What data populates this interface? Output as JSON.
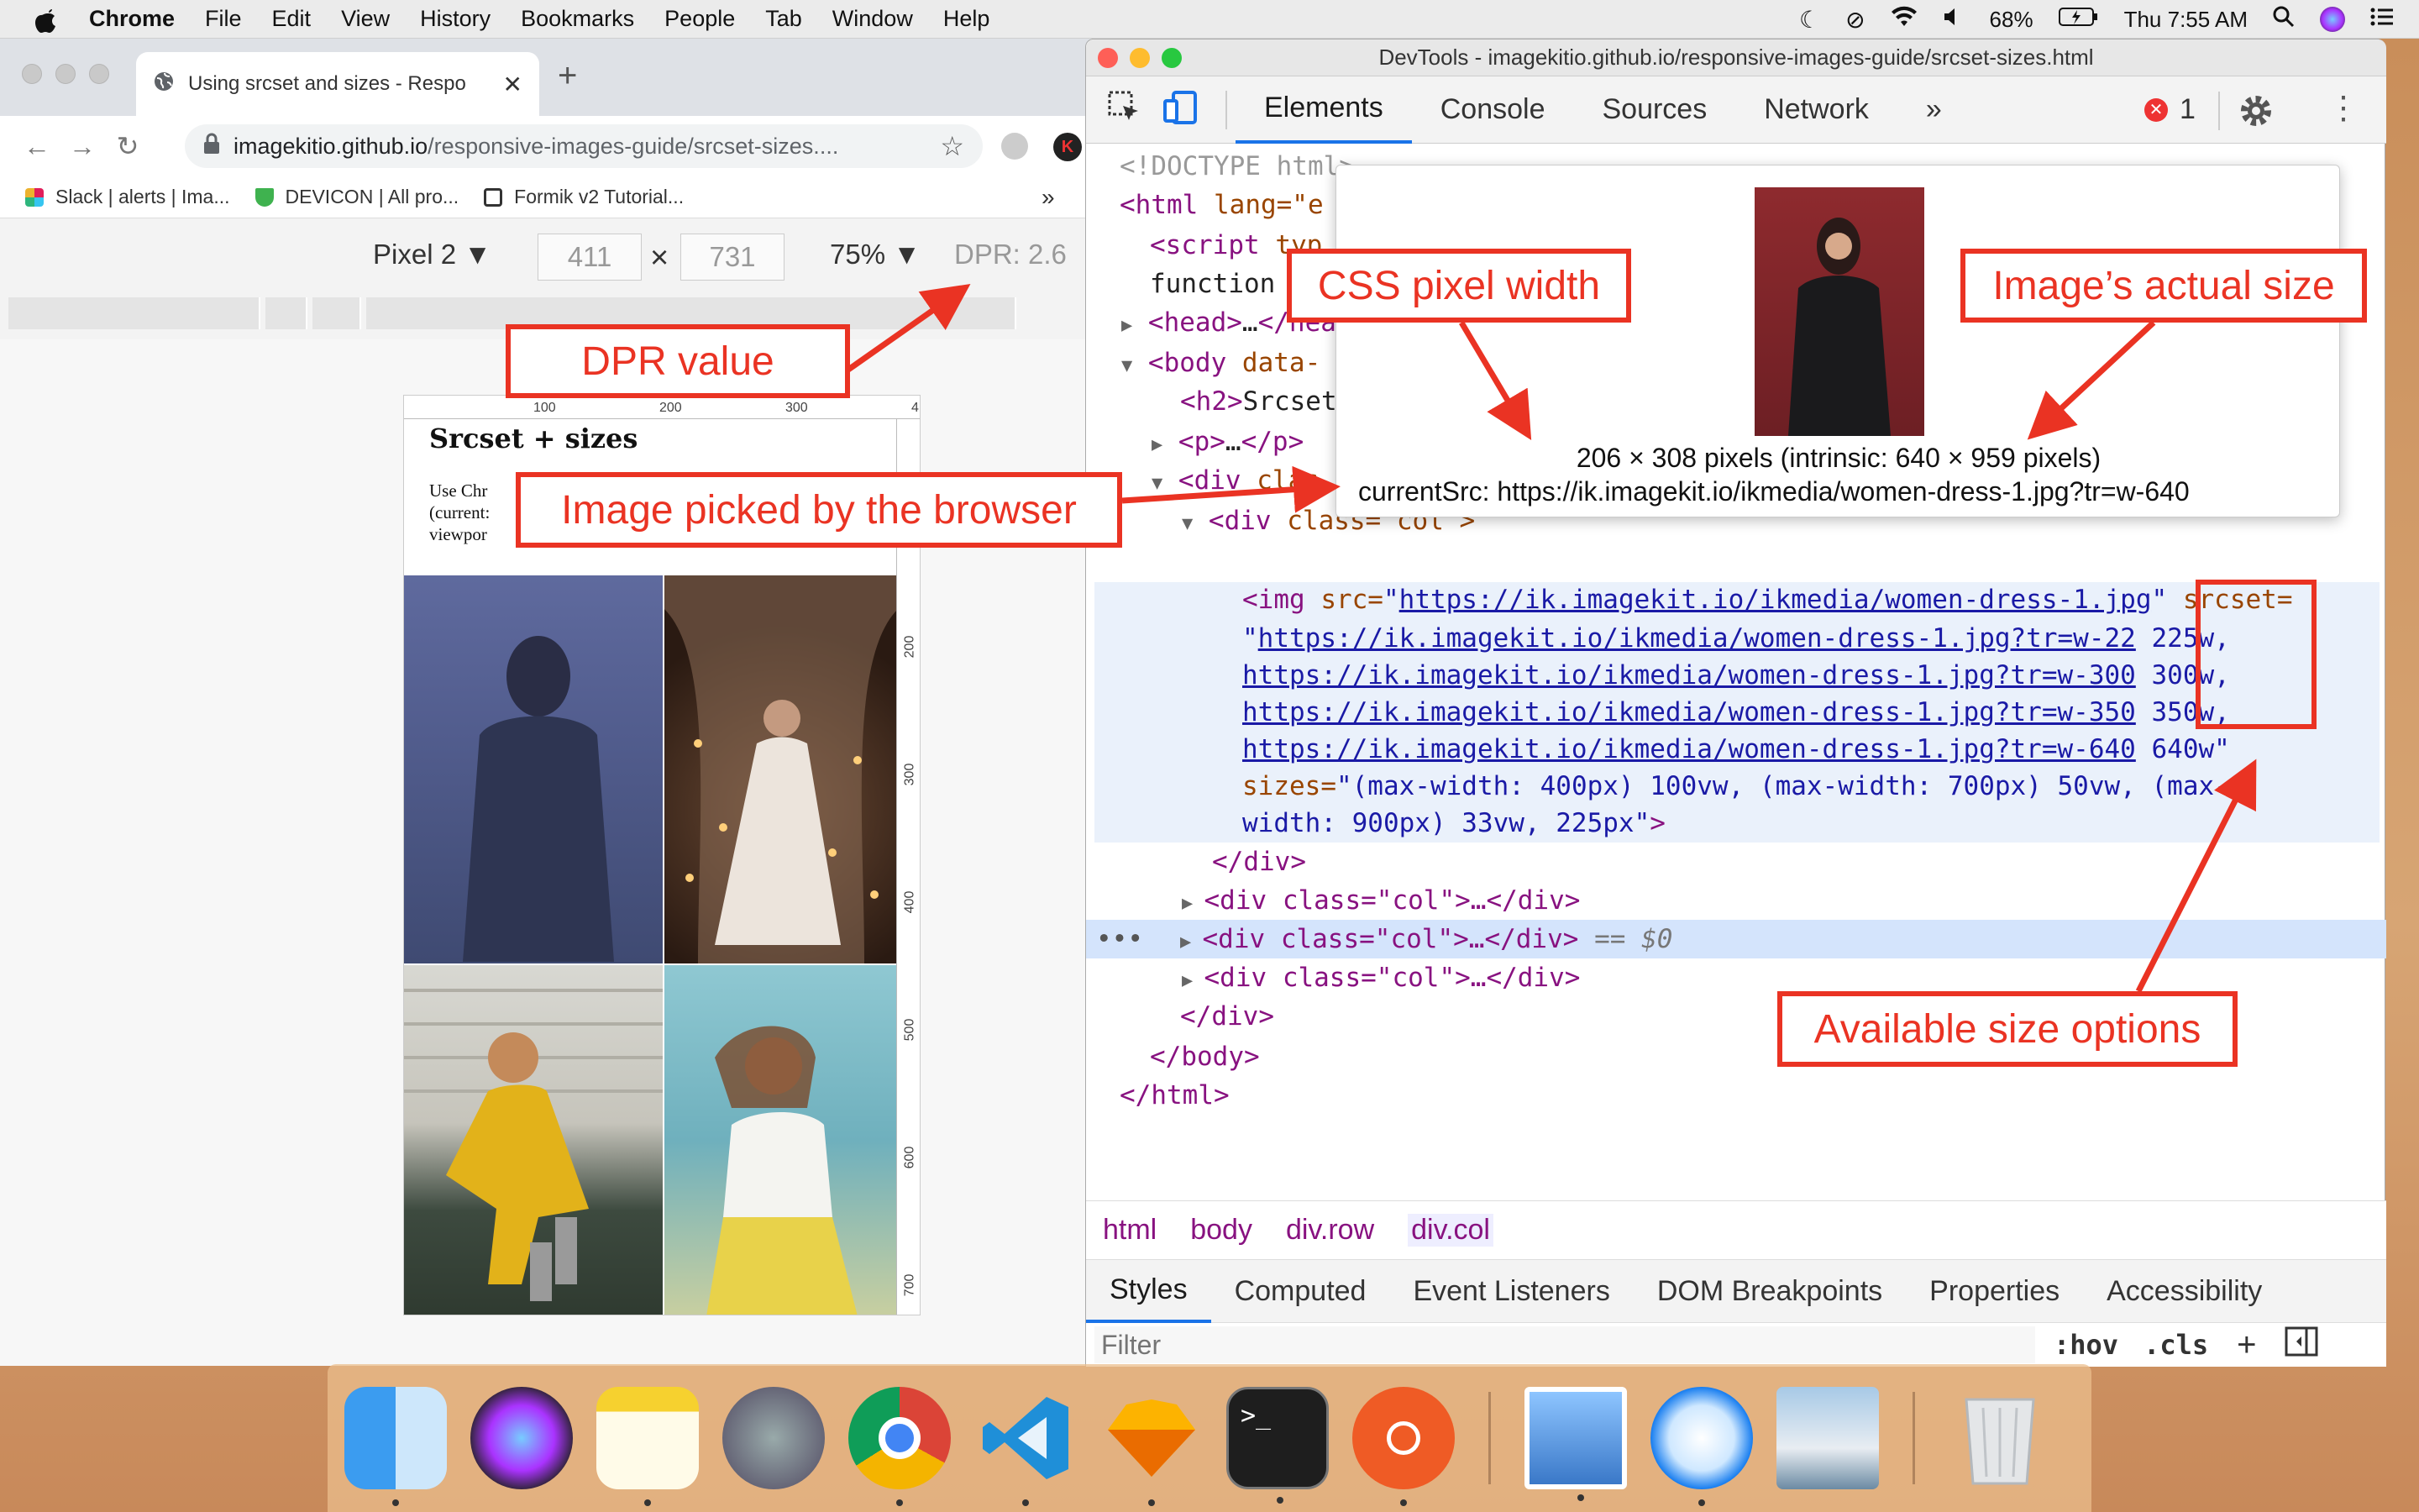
{
  "menubar": {
    "app": "Chrome",
    "items": [
      "File",
      "Edit",
      "View",
      "History",
      "Bookmarks",
      "People",
      "Tab",
      "Window",
      "Help"
    ],
    "battery": "68%",
    "clock": "Thu 7:55 AM"
  },
  "chrome": {
    "tab_title": "Using srcset and sizes - Respo",
    "url_host": "imagekitio.github.io",
    "url_path": "/responsive-images-guide/srcset-sizes....",
    "bookmarks": [
      "Slack | alerts | Ima...",
      "DEVICON | All pro...",
      "Formik v2 Tutorial..."
    ],
    "bookmarks_more": "»",
    "device": "Pixel 2 ▼",
    "width": "411",
    "times": "×",
    "height": "731",
    "zoom": "75% ▼",
    "dpr": "DPR: 2.6"
  },
  "page": {
    "heading": "Srcset + sizes",
    "para_lines": [
      "Use Chr",
      "(current:",
      "viewpor"
    ],
    "ruler_top": [
      "100",
      "200",
      "300",
      "4"
    ],
    "ruler_side": [
      "200",
      "300",
      "400",
      "500",
      "600",
      "700"
    ]
  },
  "devtools": {
    "title": "DevTools - imagekitio.github.io/responsive-images-guide/srcset-sizes.html",
    "tabs": [
      "Elements",
      "Console",
      "Sources",
      "Network",
      "»"
    ],
    "error_count": "1",
    "code": {
      "l1": "<!DOCTYPE html>",
      "l2a": "<html",
      "l2b": " lang=\"e",
      "l3a": "<script",
      "l3b": " typ",
      "l4": "function",
      "l5a": "▶",
      "l5b": "<head>",
      "l5c": "…",
      "l5d": "</hea",
      "l6a": "▼",
      "l6b": "<body",
      "l6c": " data-",
      "l7a": "<h2>",
      "l7b": "Srcset",
      "l8a": "▶",
      "l8b": "<p>",
      "l8c": "…",
      "l8d": "</p>",
      "l9a": "▼",
      "l9b": "<div",
      "l9c": " clas",
      "l10a": "▼",
      "l10b": "<div",
      "l10c": " class=\"col\">",
      "img_open": "<img",
      "src_attr": " src=",
      "src_val": "https://ik.imagekit.io/ikmedia/women-dress-1.jpg",
      "srcset_attr": " srcset=",
      "ss1": "https://ik.imagekit.io/ikmedia/women-dress-1.jpg?tr=w-22",
      "ss1w": " 225w,",
      "ss2": "https://ik.imagekit.io/ikmedia/women-dress-1.jpg?tr=w-300",
      "ss2w": " 300w,",
      "ss3": "https://ik.imagekit.io/ikmedia/women-dress-1.jpg?tr=w-350",
      "ss3w": " 350w,",
      "ss4": "https://ik.imagekit.io/ikmedia/women-dress-1.jpg?tr=w-640",
      "ss4w": " 640w\"",
      "sizes_attr": "sizes=",
      "sizes_val1": "\"(max-width: 400px) 100vw, (max-width: 700px) 50vw, (max-",
      "sizes_val2": "width: 900px) 33vw, 225px\"",
      "sizes_close": ">",
      "close_div": "</div>",
      "col1": "<div class=\"col\">…</div>",
      "col2": "<div class=\"col\">…</div>",
      "sel_marker": " == $0",
      "col3": "<div class=\"col\">…</div>",
      "end_div": "</div>",
      "end_body": "</body>",
      "end_html": "</html>",
      "dots": "•••"
    },
    "tooltip": {
      "dims": "206 × 308 pixels (intrinsic: 640 × 959 pixels)",
      "current_src": "currentSrc: https://ik.imagekit.io/ikmedia/women-dress-1.jpg?tr=w-640"
    },
    "breadcrumbs": [
      "html",
      "body",
      "div.row",
      "div.col"
    ],
    "subtabs": [
      "Styles",
      "Computed",
      "Event Listeners",
      "DOM Breakpoints",
      "Properties",
      "Accessibility"
    ],
    "filter_placeholder": "Filter",
    "hov": ":hov",
    "cls": ".cls",
    "plus": "+"
  },
  "annotations": {
    "dpr": "DPR value",
    "css_width": "CSS pixel width",
    "actual_size": "Image’s actual size",
    "picked": "Image picked by the browser",
    "options": "Available size options"
  },
  "colors": {
    "accent": "#ea3323",
    "tab_active": "#1a73e8"
  }
}
